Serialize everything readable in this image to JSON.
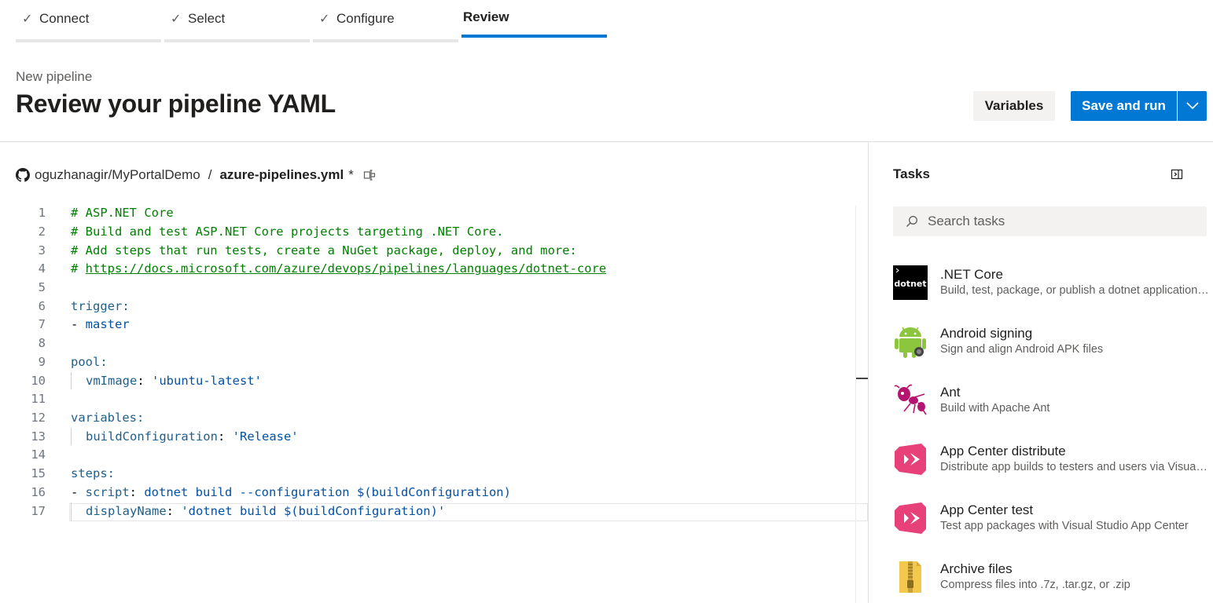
{
  "wizard": {
    "steps": [
      {
        "label": "Connect",
        "done": true
      },
      {
        "label": "Select",
        "done": true
      },
      {
        "label": "Configure",
        "done": true
      },
      {
        "label": "Review",
        "done": false,
        "active": true
      }
    ],
    "check_glyph": "✓"
  },
  "header": {
    "subtitle": "New pipeline",
    "title": "Review your pipeline YAML",
    "variables_label": "Variables",
    "save_run_label": "Save and run"
  },
  "file": {
    "repo": "oguzhanagir/MyPortalDemo",
    "separator": "/",
    "filename": "azure-pipelines.yml",
    "modified_marker": "*"
  },
  "editor": {
    "lines": [
      {
        "n": "1",
        "text": "# ASP.NET Core"
      },
      {
        "n": "2",
        "text": "# Build and test ASP.NET Core projects targeting .NET Core."
      },
      {
        "n": "3",
        "text": "# Add steps that run tests, create a NuGet package, deploy, and more:"
      },
      {
        "n": "4",
        "text": "https://docs.microsoft.com/azure/devops/pipelines/languages/dotnet-core"
      },
      {
        "n": "5",
        "text": ""
      },
      {
        "n": "6",
        "text": "trigger:"
      },
      {
        "n": "7",
        "text": "master"
      },
      {
        "n": "8",
        "text": ""
      },
      {
        "n": "9",
        "text": "pool:"
      },
      {
        "n": "10",
        "text": "vmImage: 'ubuntu-latest'"
      },
      {
        "n": "11",
        "text": ""
      },
      {
        "n": "12",
        "text": "variables:"
      },
      {
        "n": "13",
        "text": "buildConfiguration: 'Release'"
      },
      {
        "n": "14",
        "text": ""
      },
      {
        "n": "15",
        "text": "steps:"
      },
      {
        "n": "16",
        "text": "script: dotnet build --configuration $(buildConfiguration)"
      },
      {
        "n": "17",
        "text": "displayName: 'dotnet build $(buildConfiguration)'"
      }
    ]
  },
  "tasks": {
    "title": "Tasks",
    "search_placeholder": "Search tasks",
    "items": [
      {
        "name": ".NET Core",
        "desc": "Build, test, package, or publish a dotnet application, or run a custom dotnet command",
        "icon": "dotnet-icon",
        "icon_text": "dotnet"
      },
      {
        "name": "Android signing",
        "desc": "Sign and align Android APK files",
        "icon": "android-icon"
      },
      {
        "name": "Ant",
        "desc": "Build with Apache Ant",
        "icon": "ant-icon"
      },
      {
        "name": "App Center distribute",
        "desc": "Distribute app builds to testers and users via Visual Studio App Center",
        "icon": "app-center-icon"
      },
      {
        "name": "App Center test",
        "desc": "Test app packages with Visual Studio App Center",
        "icon": "app-center-icon"
      },
      {
        "name": "Archive files",
        "desc": "Compress files into .7z, .tar.gz, or .zip",
        "icon": "archive-icon"
      }
    ]
  },
  "colors": {
    "accent": "#0078d4",
    "comment": "#008000",
    "key": "#1f5f8b",
    "string": "#0451a5"
  }
}
